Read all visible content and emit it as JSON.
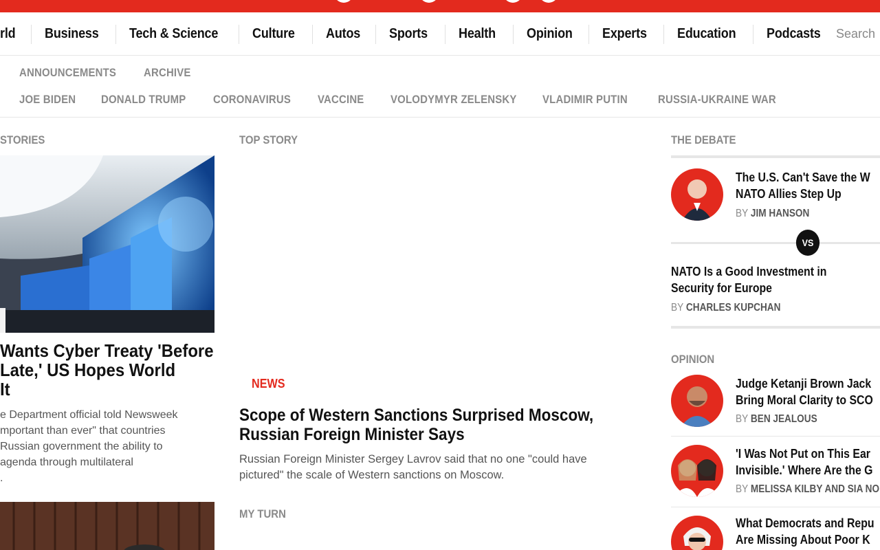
{
  "main_nav": {
    "items": [
      "rld",
      "Business",
      "Tech & Science",
      "Culture",
      "Autos",
      "Sports",
      "Health",
      "Opinion",
      "Experts",
      "Education",
      "Podcasts"
    ],
    "search_placeholder": "Search"
  },
  "sub_nav": {
    "items": [
      "ANNOUNCEMENTS",
      "ARCHIVE"
    ]
  },
  "topics": {
    "items": [
      "JOE BIDEN",
      "DONALD TRUMP",
      "CORONAVIRUS",
      "VACCINE",
      "VOLODYMYR ZELENSKY",
      "VLADIMIR PUTIN",
      "RUSSIA-UKRAINE WAR"
    ]
  },
  "left_col": {
    "label": "STORIES",
    "headline": [
      "Wants Cyber Treaty 'Before",
      "Late,' US Hopes World",
      "It"
    ],
    "body": [
      "e Department official told Newsweek",
      "mportant than ever\" that countries",
      "Russian government the ability to",
      "agenda through multilateral",
      "."
    ]
  },
  "top_story": {
    "label": "TOP STORY",
    "kicker": "NEWS",
    "headline": [
      "Scope of Western Sanctions Surprised Moscow,",
      "Russian Foreign Minister Says"
    ],
    "body": [
      "Russian Foreign Minister Sergey Lavrov said that no one \"could have",
      "pictured\" the scale of Western sanctions on Moscow."
    ],
    "my_turn_label": "MY TURN"
  },
  "debate": {
    "label": "THE DEBATE",
    "first": {
      "title": [
        "The U.S. Can't Save the W",
        "NATO Allies Step Up"
      ],
      "by": "BY",
      "author": "JIM HANSON"
    },
    "vs": "VS",
    "second": {
      "title": [
        "NATO Is a Good Investment in",
        "Security for Europe"
      ],
      "by": "BY",
      "author": "CHARLES KUPCHAN"
    }
  },
  "opinion": {
    "label": "OPINION",
    "items": [
      {
        "title": [
          "Judge Ketanji Brown Jack",
          "Bring Moral Clarity to SCO"
        ],
        "by": "BY",
        "author": "BEN JEALOUS"
      },
      {
        "title": [
          "'I Was Not Put on This Ear",
          "Invisible.' Where Are the G"
        ],
        "by": "BY",
        "author": "MELISSA KILBY AND SIA NO"
      },
      {
        "title": [
          "What Democrats and Repu",
          "Are Missing About Poor K"
        ],
        "by": "",
        "author": ""
      }
    ]
  },
  "colors": {
    "brand_red": "#e32a1e",
    "muted": "#8a8a8a"
  }
}
